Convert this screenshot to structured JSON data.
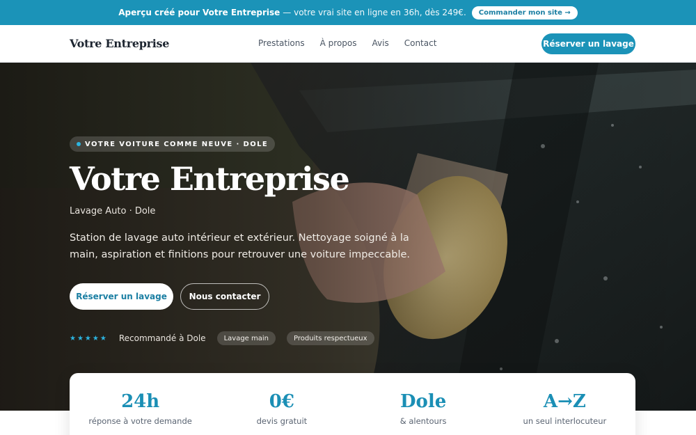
{
  "promo": {
    "strong": "Aperçu créé pour Votre Entreprise",
    "rest": "— votre vrai site en ligne en 36h, dès 249€.",
    "cta": "Commander mon site →"
  },
  "nav": {
    "brand": "Votre Entreprise",
    "links": [
      "Prestations",
      "À propos",
      "Avis",
      "Contact"
    ],
    "cta": "Réserver un lavage"
  },
  "hero": {
    "pill": "VOTRE VOITURE COMME NEUVE · DOLE",
    "title": "Votre Entreprise",
    "subtitle": "Lavage Auto · Dole",
    "description": "Station de lavage auto intérieur et extérieur. Nettoyage soigné à la main, aspiration et finitions pour retrouver une voiture impeccable.",
    "primary_button": "Réserver un lavage",
    "secondary_button": "Nous contacter",
    "stars": "★★★★★",
    "recommended": "Recommandé à Dole",
    "tags": [
      "Lavage main",
      "Produits respectueux"
    ]
  },
  "stats": [
    {
      "value": "24h",
      "label": "réponse à votre demande"
    },
    {
      "value": "0€",
      "label": "devis gratuit"
    },
    {
      "value": "Dole",
      "label": "& alentours"
    },
    {
      "value": "A→Z",
      "label": "un seul interlocuteur"
    }
  ],
  "colors": {
    "accent": "#1b93b8",
    "accent_text": "#1b8fb5",
    "star": "#2cb4e0"
  }
}
